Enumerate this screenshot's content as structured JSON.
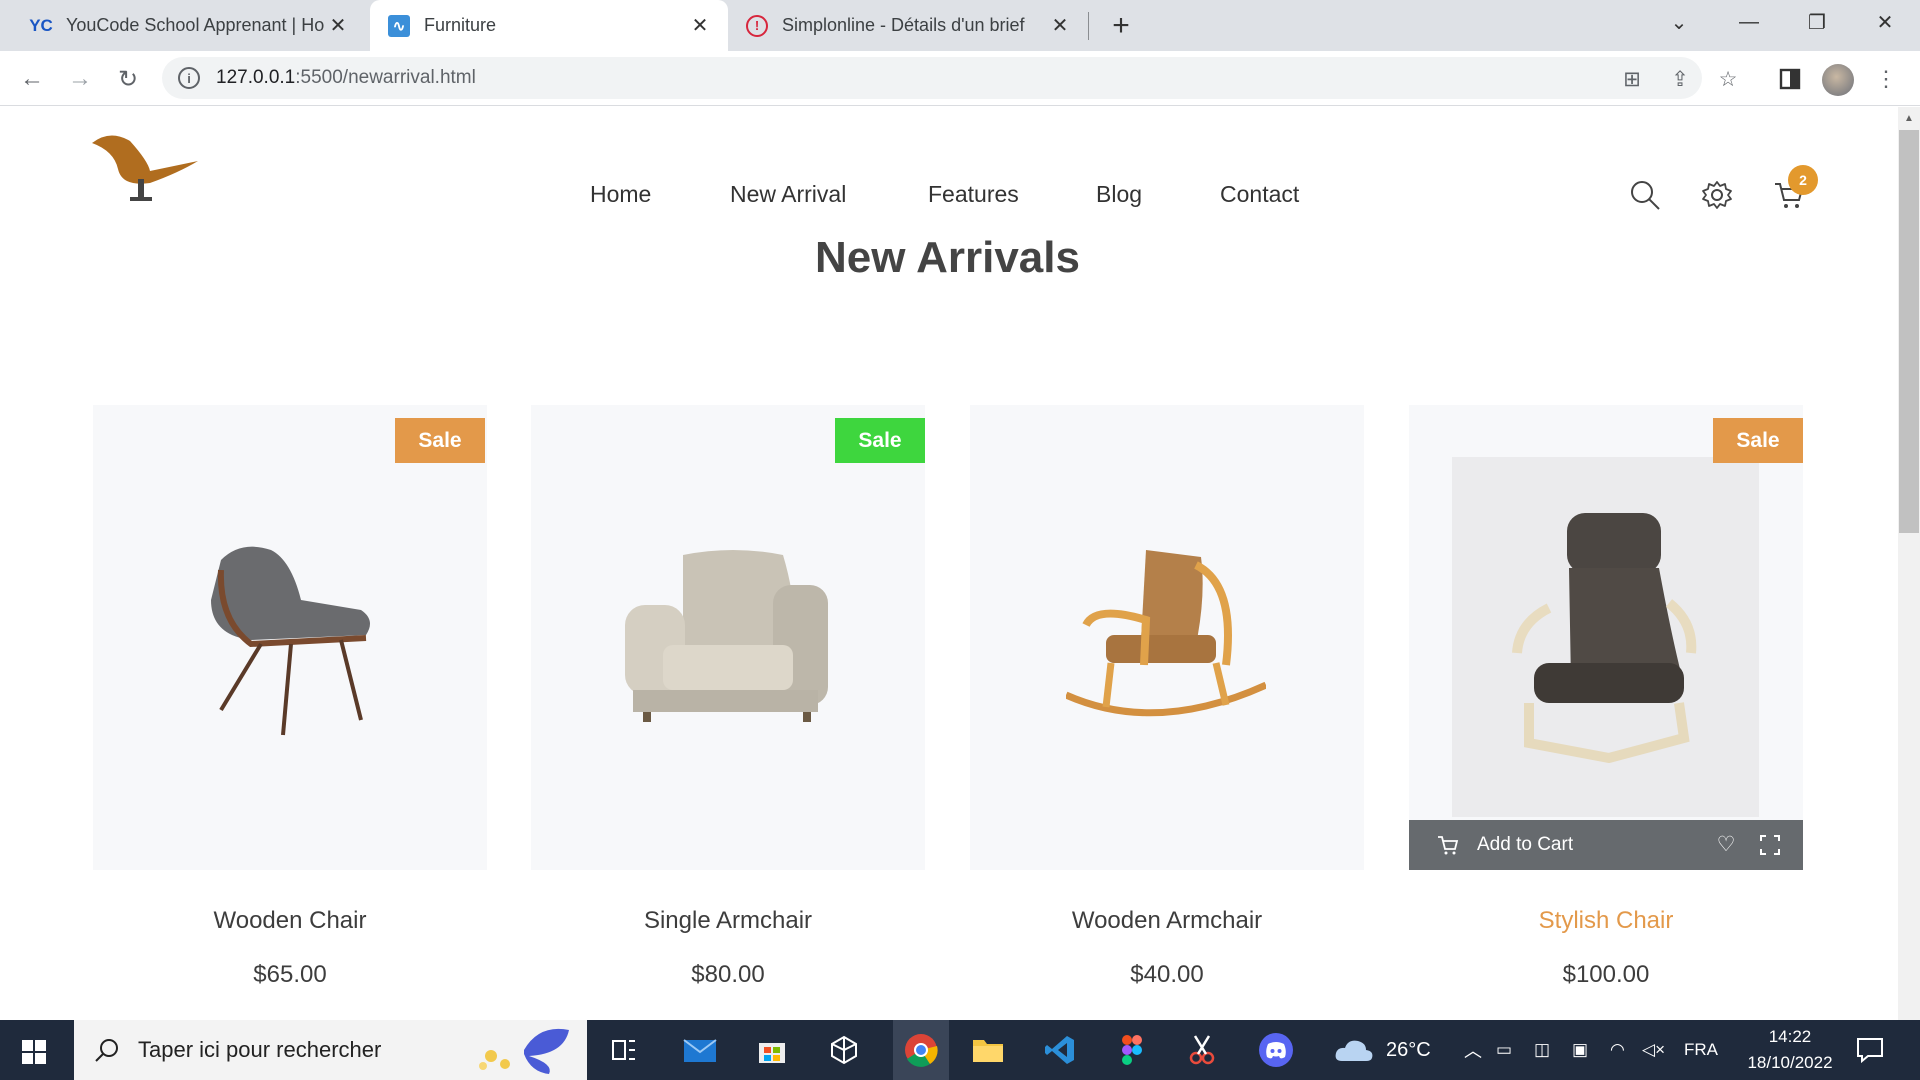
{
  "browser": {
    "tabs": [
      {
        "favicon": "YC",
        "title": "YouCode School Apprenant | Hor",
        "active": false
      },
      {
        "favicon": "∿",
        "title": "Furniture",
        "active": true
      },
      {
        "favicon": "!",
        "title": "Simplonline - Détails d'un brief",
        "active": false
      }
    ],
    "url_host": "127.0.0.1",
    "url_rest": ":5500/newarrival.html"
  },
  "site": {
    "nav": [
      "Home",
      "New Arrival",
      "Features",
      "Blog",
      "Contact"
    ],
    "cart_count": "2",
    "section_title": "New Arrivals",
    "add_to_cart": "Add to Cart",
    "products": [
      {
        "name": "Wooden Chair",
        "price": "$65.00",
        "badge": "Sale",
        "badge_color": "#e3994a"
      },
      {
        "name": "Single Armchair",
        "price": "$80.00",
        "badge": "Sale",
        "badge_color": "#3ed63e"
      },
      {
        "name": "Wooden Armchair",
        "price": "$40.00",
        "badge": ""
      },
      {
        "name": "Stylish Chair",
        "price": "$100.00",
        "badge": "Sale",
        "badge_color": "#e3994a",
        "highlight_color": "#e3994a"
      }
    ]
  },
  "taskbar": {
    "search_placeholder": "Taper ici pour rechercher",
    "weather": "26°C",
    "language": "FRA",
    "time": "14:22",
    "date": "18/10/2022"
  },
  "colors": {
    "accent": "#e3994a",
    "taskbar": "#1f2a3c"
  }
}
